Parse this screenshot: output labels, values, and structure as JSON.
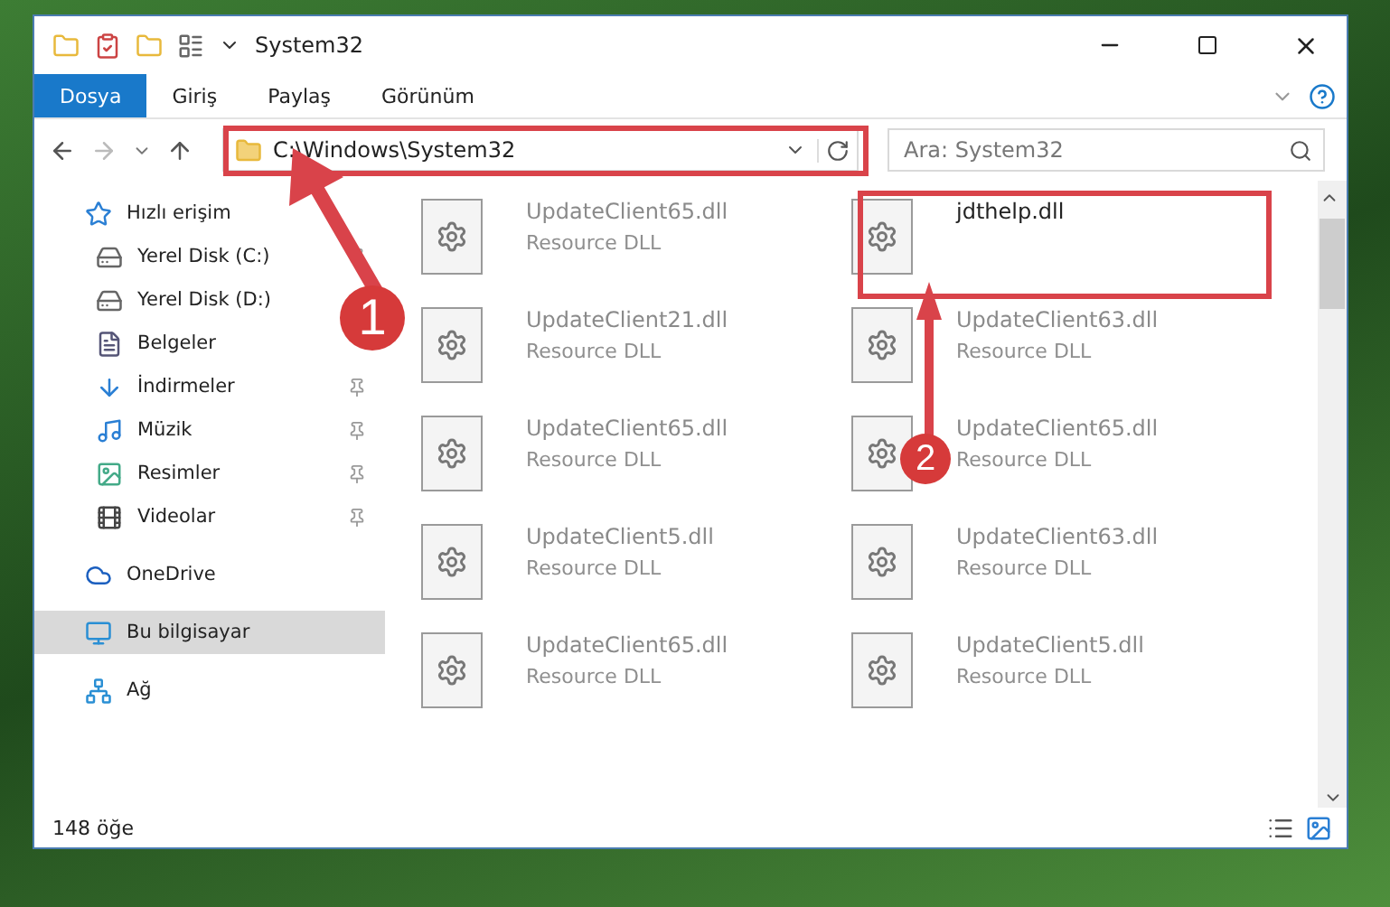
{
  "window": {
    "title": "System32"
  },
  "ribbon_tabs": [
    {
      "label": "Dosya",
      "kind": "file"
    },
    {
      "label": "Giriş",
      "kind": "tab"
    },
    {
      "label": "Paylaş",
      "kind": "tab"
    },
    {
      "label": "Görünüm",
      "kind": "tab"
    }
  ],
  "address": {
    "path": "C:\\Windows\\System32"
  },
  "search": {
    "placeholder": "Ara: System32"
  },
  "sidebar": {
    "items": [
      {
        "label": "Hızlı erişim",
        "kind": "star",
        "selected": false,
        "children": [
          {
            "label": "Yerel Disk (C:)",
            "kind": "drive-c",
            "pinned": true
          },
          {
            "label": "Yerel Disk (D:)",
            "kind": "drive",
            "pinned": false
          },
          {
            "label": "Belgeler",
            "kind": "docs",
            "pinned": false
          },
          {
            "label": "İndirmeler",
            "kind": "download",
            "pinned": true
          },
          {
            "label": "Müzik",
            "kind": "music",
            "pinned": true
          },
          {
            "label": "Resimler",
            "kind": "pictures",
            "pinned": true
          },
          {
            "label": "Videolar",
            "kind": "video",
            "pinned": true
          }
        ]
      },
      {
        "label": "OneDrive",
        "kind": "cloud",
        "selected": false
      },
      {
        "label": "Bu bilgisayar",
        "kind": "computer",
        "selected": true
      },
      {
        "label": "Ağ",
        "kind": "network",
        "selected": false
      }
    ]
  },
  "files": [
    {
      "name": "UpdateClient65.dll",
      "type": "Resource DLL",
      "faded": true
    },
    {
      "name": "jdthelp.dll",
      "faded": false
    },
    {
      "name": "UpdateClient21.dll",
      "type": "Resource DLL",
      "faded": true
    },
    {
      "name": "UpdateClient63.dll",
      "type": "Resource DLL",
      "faded": true
    },
    {
      "name": "UpdateClient65.dll",
      "type": "Resource DLL",
      "faded": true
    },
    {
      "name": "UpdateClient65.dll",
      "type": "Resource DLL",
      "faded": true
    },
    {
      "name": "UpdateClient5.dll",
      "type": "Resource DLL",
      "faded": true
    },
    {
      "name": "UpdateClient63.dll",
      "type": "Resource DLL",
      "faded": true
    },
    {
      "name": "UpdateClient65.dll",
      "type": "Resource DLL",
      "faded": true
    },
    {
      "name": "UpdateClient5.dll",
      "type": "Resource DLL",
      "faded": true
    }
  ],
  "status_bar": {
    "count": "148 öğe"
  },
  "annotations": [
    {
      "label": "1"
    },
    {
      "label": "2"
    }
  ]
}
